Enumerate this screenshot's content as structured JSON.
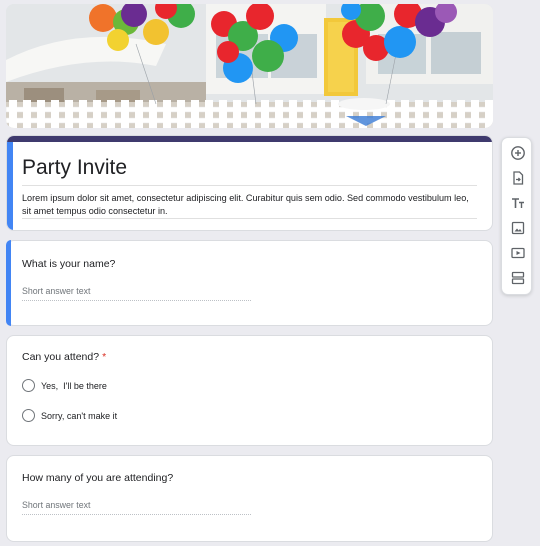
{
  "form": {
    "title": "Party Invite",
    "description": "Lorem ipsum dolor sit amet, consectetur adipiscing elit. Curabitur quis sem odio. Sed commodo vestibulum leo, sit amet tempus odio consectetur in."
  },
  "questions": [
    {
      "title": "What is your name?",
      "type": "short_answer",
      "placeholder": "Short answer text",
      "required": false
    },
    {
      "title": "Can you attend?",
      "type": "multiple_choice",
      "required": true,
      "required_mark": "*",
      "options": [
        "Yes,  I'll be there",
        "Sorry, can't make it"
      ]
    },
    {
      "title": "How many of you are attending?",
      "type": "short_answer",
      "placeholder": "Short answer text",
      "required": false
    }
  ],
  "toolbar": {
    "items": [
      "add-question-icon",
      "import-questions-icon",
      "add-title-icon",
      "add-image-icon",
      "add-video-icon",
      "add-section-icon"
    ]
  },
  "colors": {
    "theme": "#3f3a6e",
    "active_accent": "#4285f4",
    "required": "#d93025",
    "background": "#ebebf0"
  }
}
